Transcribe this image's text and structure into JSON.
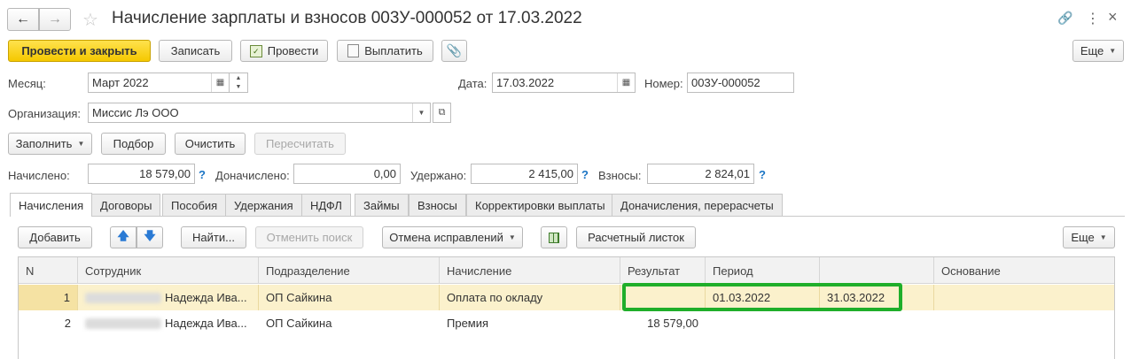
{
  "window": {
    "title": "Начисление зарплаты и взносов 003У-000052 от 17.03.2022"
  },
  "toolbar": {
    "post_close": "Провести и закрыть",
    "save": "Записать",
    "post": "Провести",
    "pay": "Выплатить",
    "more": "Еще"
  },
  "fields": {
    "month_label": "Месяц:",
    "month_value": "Март 2022",
    "date_label": "Дата:",
    "date_value": "17.03.2022",
    "number_label": "Номер:",
    "number_value": "003У-000052",
    "org_label": "Организация:",
    "org_value": "Миссис Лэ ООО"
  },
  "actions": {
    "fill": "Заполнить",
    "select": "Подбор",
    "clear": "Очистить",
    "recalc": "Пересчитать"
  },
  "totals": {
    "accrued_label": "Начислено:",
    "accrued_value": "18 579,00",
    "extra_label": "Доначислено:",
    "extra_value": "0,00",
    "withheld_label": "Удержано:",
    "withheld_value": "2 415,00",
    "contrib_label": "Взносы:",
    "contrib_value": "2 824,01",
    "help": "?"
  },
  "tabs": [
    {
      "label": "Начисления"
    },
    {
      "label": "Договоры"
    },
    {
      "label": "Пособия"
    },
    {
      "label": "Удержания"
    },
    {
      "label": "НДФЛ"
    },
    {
      "label": "Займы"
    },
    {
      "label": "Взносы"
    },
    {
      "label": "Корректировки выплаты"
    },
    {
      "label": "Доначисления, перерасчеты"
    }
  ],
  "table_toolbar": {
    "add": "Добавить",
    "find": "Найти...",
    "cancel_search": "Отменить поиск",
    "cancel_fixes": "Отмена исправлений",
    "payslip": "Расчетный листок",
    "more": "Еще"
  },
  "table": {
    "columns": [
      "N",
      "Сотрудник",
      "Подразделение",
      "Начисление",
      "Результат",
      "Период",
      "",
      "Основание"
    ],
    "rows": [
      {
        "n": "1",
        "employee": "Надежда Ива...",
        "dept": "ОП Сайкина",
        "accrual": "Оплата по окладу",
        "result": "",
        "period_from": "01.03.2022",
        "period_to": "31.03.2022",
        "basis": ""
      },
      {
        "n": "2",
        "employee": "Надежда Ива...",
        "dept": "ОП Сайкина",
        "accrual": "Премия",
        "result": "18 579,00",
        "period_from": "",
        "period_to": "",
        "basis": ""
      }
    ]
  },
  "colors": {
    "accent_yellow": "#f5c800",
    "highlight_green": "#1fae2a",
    "selected_row": "#fbf1cc",
    "help_blue": "#1a74c4"
  }
}
